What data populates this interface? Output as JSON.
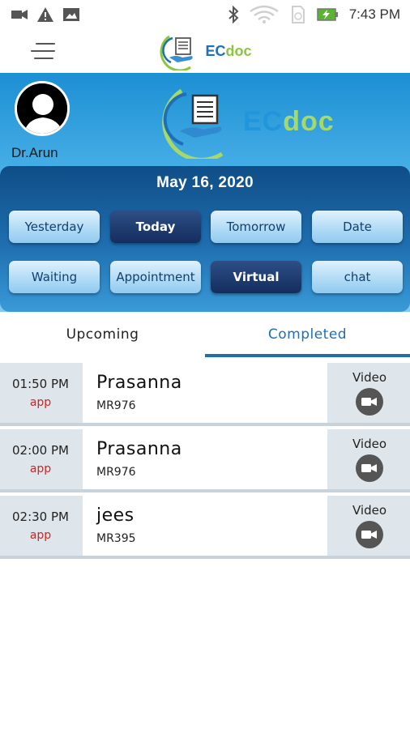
{
  "status_bar": {
    "time": "7:43 PM",
    "icons": [
      "video-camera-icon",
      "alert-icon",
      "image-icon",
      "bluetooth-icon",
      "wifi-icon",
      "sim-card-icon",
      "battery-charging-icon"
    ]
  },
  "app_bar": {
    "menu_icon": "hamburger-menu-icon",
    "logo_ec": "EC",
    "logo_doc": "doc"
  },
  "header": {
    "doctor_name": "Dr.Arun",
    "logo_ec": "EC",
    "logo_doc": "doc"
  },
  "date_panel": {
    "date": "May 16, 2020",
    "row1": [
      {
        "label": "Yesterday",
        "selected": false
      },
      {
        "label": "Today",
        "selected": true
      },
      {
        "label": "Tomorrow",
        "selected": false
      },
      {
        "label": "Date",
        "selected": false
      }
    ],
    "row2": [
      {
        "label": "Waiting",
        "selected": false
      },
      {
        "label": "Appointment",
        "selected": false
      },
      {
        "label": "Virtual",
        "selected": true
      },
      {
        "label": "chat",
        "selected": false
      }
    ]
  },
  "tabs": [
    {
      "label": "Upcoming",
      "active": false
    },
    {
      "label": "Completed",
      "active": true
    }
  ],
  "appointments": [
    {
      "time": "01:50 PM",
      "type": "app",
      "name": "Prasanna",
      "id": "MR976",
      "action": "Video",
      "action_icon": "video-camera-icon"
    },
    {
      "time": "02:00 PM",
      "type": "app",
      "name": "Prasanna",
      "id": "MR976",
      "action": "Video",
      "action_icon": "video-camera-icon"
    },
    {
      "time": "02:30 PM",
      "type": "app",
      "name": "jees",
      "id": "MR395",
      "action": "Video",
      "action_icon": "video-camera-icon"
    }
  ],
  "colors": {
    "accent": "#1f6fb0",
    "type_red": "#c62828",
    "logo_green": "#8cc63f"
  }
}
